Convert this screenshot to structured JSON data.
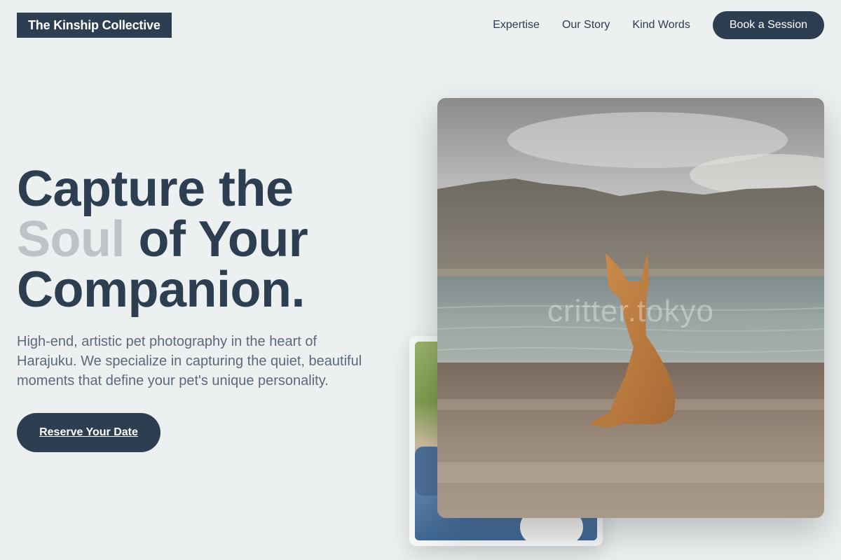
{
  "brand": {
    "name": "The Kinship Collective"
  },
  "nav": {
    "links": [
      "Expertise",
      "Our Story",
      "Kind Words"
    ],
    "cta": "Book a Session"
  },
  "hero": {
    "headline_line1": "Capture the",
    "headline_accent": "Soul",
    "headline_line2_rest": " of Your",
    "headline_line3": "Companion.",
    "subtext": "High-end, artistic pet photography in the heart of Harajuku. We specialize in capturing the quiet, beautiful moments that define your pet's unique personality.",
    "button": "Reserve Your Date"
  },
  "gallery": {
    "main_watermark": "critter.tokyo"
  },
  "colors": {
    "background": "#ecf0f1",
    "primary": "#2c3e50",
    "accent_text": "#bdc3c7",
    "body_text": "#5a6a7a"
  }
}
